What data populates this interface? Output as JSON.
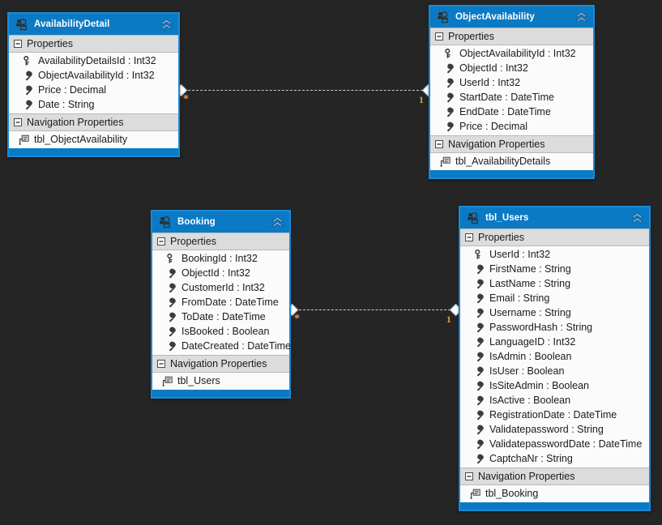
{
  "canvas": {
    "background": "#252526",
    "accent": "#0b7ac4",
    "border": "#1c8ad6",
    "multiplicity_color": "#e8a13a"
  },
  "icons": {
    "entity": "entity-icon",
    "collapse_chevron": "chevron-double-up-icon",
    "section_collapse": "collapse-box-icon",
    "key": "key-icon",
    "scalar": "wrench-icon",
    "navigation": "navigation-property-icon"
  },
  "section_labels": {
    "properties": "Properties",
    "navigation_properties": "Navigation Properties"
  },
  "entities": [
    {
      "id": "availability-detail",
      "title": "AvailabilityDetail",
      "properties": [
        {
          "name": "AvailabilityDetailsId : Int32",
          "icon": "key"
        },
        {
          "name": "ObjectAvailabilityId : Int32",
          "icon": "scalar"
        },
        {
          "name": "Price : Decimal",
          "icon": "scalar"
        },
        {
          "name": "Date : String",
          "icon": "scalar"
        }
      ],
      "navigation_properties": [
        {
          "name": "tbl_ObjectAvailability",
          "icon": "navigation"
        }
      ]
    },
    {
      "id": "object-availability",
      "title": "ObjectAvailability",
      "properties": [
        {
          "name": "ObjectAvailabilityId : Int32",
          "icon": "key"
        },
        {
          "name": "ObjectId : Int32",
          "icon": "scalar"
        },
        {
          "name": "UserId : Int32",
          "icon": "scalar"
        },
        {
          "name": "StartDate : DateTime",
          "icon": "scalar"
        },
        {
          "name": "EndDate : DateTime",
          "icon": "scalar"
        },
        {
          "name": "Price : Decimal",
          "icon": "scalar"
        }
      ],
      "navigation_properties": [
        {
          "name": "tbl_AvailabilityDetails",
          "icon": "navigation"
        }
      ]
    },
    {
      "id": "booking",
      "title": "Booking",
      "properties": [
        {
          "name": "BookingId : Int32",
          "icon": "key"
        },
        {
          "name": "ObjectId : Int32",
          "icon": "scalar"
        },
        {
          "name": "CustomerId : Int32",
          "icon": "scalar"
        },
        {
          "name": "FromDate : DateTime",
          "icon": "scalar"
        },
        {
          "name": "ToDate : DateTime",
          "icon": "scalar"
        },
        {
          "name": "IsBooked : Boolean",
          "icon": "scalar"
        },
        {
          "name": "DateCreated : DateTime",
          "icon": "scalar"
        }
      ],
      "navigation_properties": [
        {
          "name": "tbl_Users",
          "icon": "navigation"
        }
      ]
    },
    {
      "id": "tbl-users",
      "title": "tbl_Users",
      "properties": [
        {
          "name": "UserId : Int32",
          "icon": "key"
        },
        {
          "name": "FirstName : String",
          "icon": "scalar"
        },
        {
          "name": "LastName : String",
          "icon": "scalar"
        },
        {
          "name": "Email : String",
          "icon": "scalar"
        },
        {
          "name": "Username : String",
          "icon": "scalar"
        },
        {
          "name": "PasswordHash : String",
          "icon": "scalar"
        },
        {
          "name": "LanguageID : Int32",
          "icon": "scalar"
        },
        {
          "name": "IsAdmin : Boolean",
          "icon": "scalar"
        },
        {
          "name": "IsUser : Boolean",
          "icon": "scalar"
        },
        {
          "name": "IsSiteAdmin : Boolean",
          "icon": "scalar"
        },
        {
          "name": "IsActive : Boolean",
          "icon": "scalar"
        },
        {
          "name": "RegistrationDate : DateTime",
          "icon": "scalar"
        },
        {
          "name": "Validatepassword : String",
          "icon": "scalar"
        },
        {
          "name": "ValidatepasswordDate : DateTime",
          "icon": "scalar"
        },
        {
          "name": "CaptchaNr : String",
          "icon": "scalar"
        }
      ],
      "navigation_properties": [
        {
          "name": "tbl_Booking",
          "icon": "navigation"
        }
      ]
    }
  ],
  "associations": [
    {
      "id": "assoc-availabilitydetail-objectavailability",
      "from_multiplicity": "*",
      "to_multiplicity": "1"
    },
    {
      "id": "assoc-booking-tblusers",
      "from_multiplicity": "*",
      "to_multiplicity": "1"
    }
  ]
}
